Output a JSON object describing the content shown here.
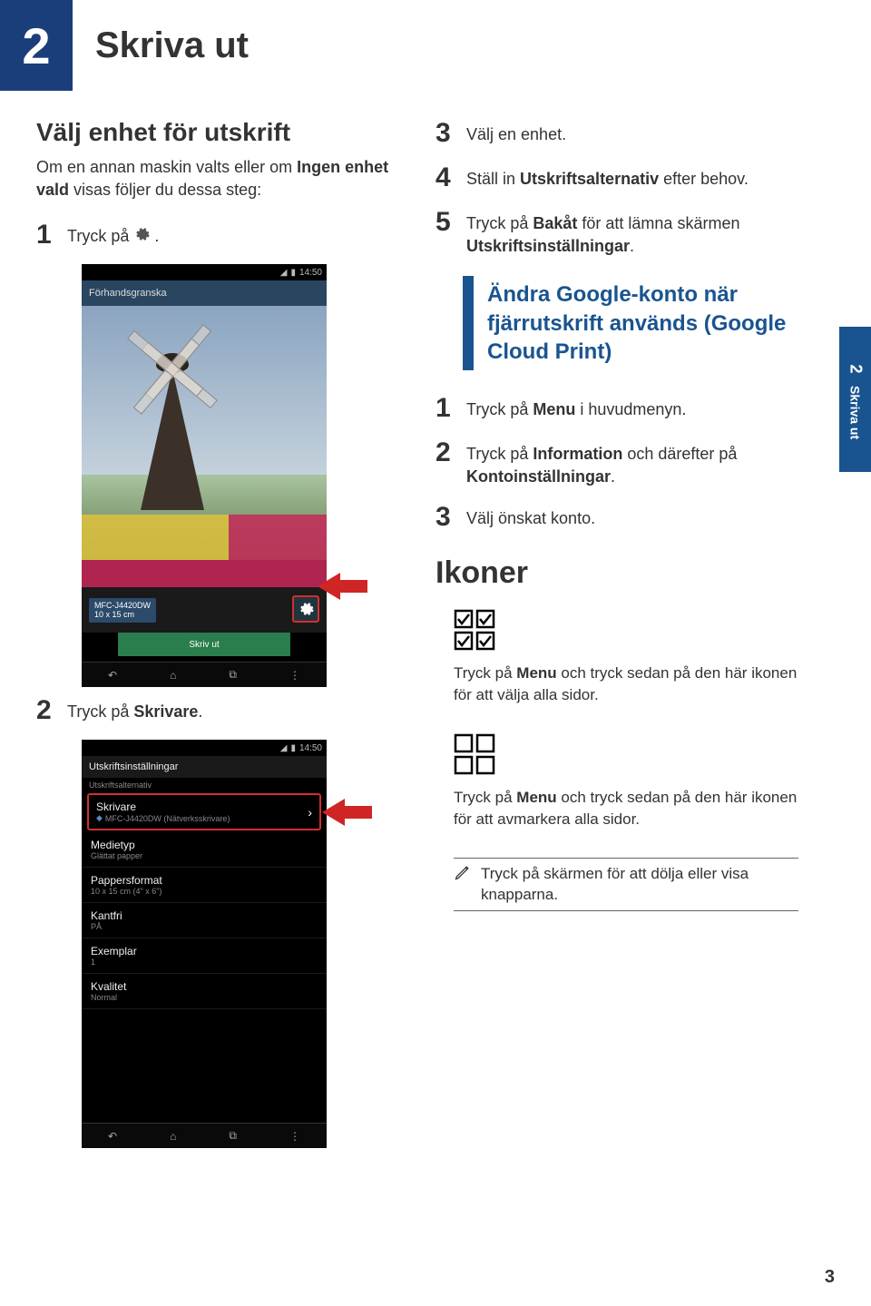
{
  "chapter": {
    "number": "2",
    "title": "Skriva ut"
  },
  "left": {
    "heading": "Välj enhet för utskrift",
    "intro_prefix": "Om en annan maskin valts eller om ",
    "intro_bold": "Ingen enhet vald",
    "intro_suffix": " visas följer du dessa steg:",
    "step1_prefix": "Tryck på ",
    "step1_suffix": ".",
    "step2_prefix": "Tryck på ",
    "step2_bold": "Skrivare",
    "step2_suffix": "."
  },
  "phone1": {
    "time": "14:50",
    "actionbar": "Förhandsgranska",
    "printer_model": "MFC-J4420DW",
    "paper_size": "10 x 15 cm",
    "print_button": "Skriv ut"
  },
  "phone2": {
    "time": "14:50",
    "header": "Utskriftsinställningar",
    "section": "Utskriftsalternativ",
    "rows": [
      {
        "label": "Skrivare",
        "value_prefix": "MFC-J4420DW (Nätverksskrivare)"
      },
      {
        "label": "Medietyp",
        "value": "Glättat papper"
      },
      {
        "label": "Pappersformat",
        "value": "10 x 15 cm (4\" x 6\")"
      },
      {
        "label": "Kantfri",
        "value": "PÅ"
      },
      {
        "label": "Exemplar",
        "value": "1"
      },
      {
        "label": "Kvalitet",
        "value": "Normal"
      }
    ]
  },
  "right": {
    "step3": "Välj en enhet.",
    "step4_prefix": "Ställ in ",
    "step4_bold": "Utskriftsalternativ",
    "step4_suffix": " efter behov.",
    "step5_prefix": "Tryck på ",
    "step5_bold": "Bakåt",
    "step5_mid": " för att lämna skärmen ",
    "step5_bold2": "Utskriftsinställningar",
    "step5_suffix": ".",
    "callout": "Ändra Google-konto när fjärrutskrift används (Google Cloud Print)",
    "r_step1_prefix": "Tryck på ",
    "r_step1_bold": "Menu",
    "r_step1_suffix": " i huvudmenyn.",
    "r_step2_prefix": "Tryck på ",
    "r_step2_bold": "Information",
    "r_step2_mid": " och därefter på ",
    "r_step2_bold2": "Kontoinställningar",
    "r_step2_suffix": ".",
    "r_step3": "Välj önskat konto.",
    "ikoner": "Ikoner",
    "icon1_desc_prefix": "Tryck på ",
    "icon1_desc_bold": "Menu",
    "icon1_desc_suffix": " och tryck sedan på den här ikonen för att välja alla sidor.",
    "icon2_desc_prefix": "Tryck på ",
    "icon2_desc_bold": "Menu",
    "icon2_desc_suffix": " och tryck sedan på den här ikonen för att avmarkera alla sidor.",
    "note": "Tryck på skärmen för att dölja eller visa knapparna."
  },
  "sidetab": {
    "num": "2",
    "label": "Skriva ut"
  },
  "page_number": "3"
}
